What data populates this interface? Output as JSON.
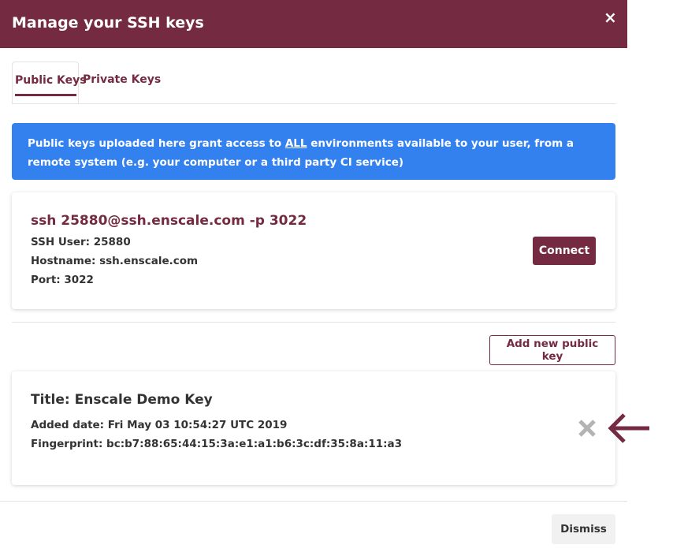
{
  "modal": {
    "title": "Manage your SSH keys",
    "close_icon": "close-icon",
    "close_glyph": "×"
  },
  "tabs": [
    {
      "label": "Public Keys",
      "active": true
    },
    {
      "label": "Private Keys",
      "active": false
    }
  ],
  "info_banner": {
    "text_before": "Public keys uploaded here grant access to ",
    "emphasis": "ALL",
    "text_after": " environments available to your user, from a remote system (e.g. your computer or a third party CI service)",
    "color": "#3381ee"
  },
  "connection": {
    "command": "ssh 25880@ssh.enscale.com -p 3022",
    "ssh_user": "SSH User: 25880",
    "hostname": "Hostname: ssh.enscale.com",
    "port": "Port: 3022",
    "connect_label": "Connect"
  },
  "add_key_label": "Add new public key",
  "keys": [
    {
      "title": "Title: Enscale Demo Key",
      "added_date": "Added date: Fri May 03 10:54:27 UTC 2019",
      "fingerprint": "Fingerprint: bc:b7:88:65:44:15:3a:e1:a1:b6:3c:df:35:8a:11:a3",
      "delete_icon": "close-icon"
    }
  ],
  "annotation_icon": "arrow-left-icon",
  "dismiss_label": "Dismiss",
  "colors": {
    "brand": "#742a40",
    "info": "#3381ee",
    "delete_icon": "#b3b3b3"
  }
}
